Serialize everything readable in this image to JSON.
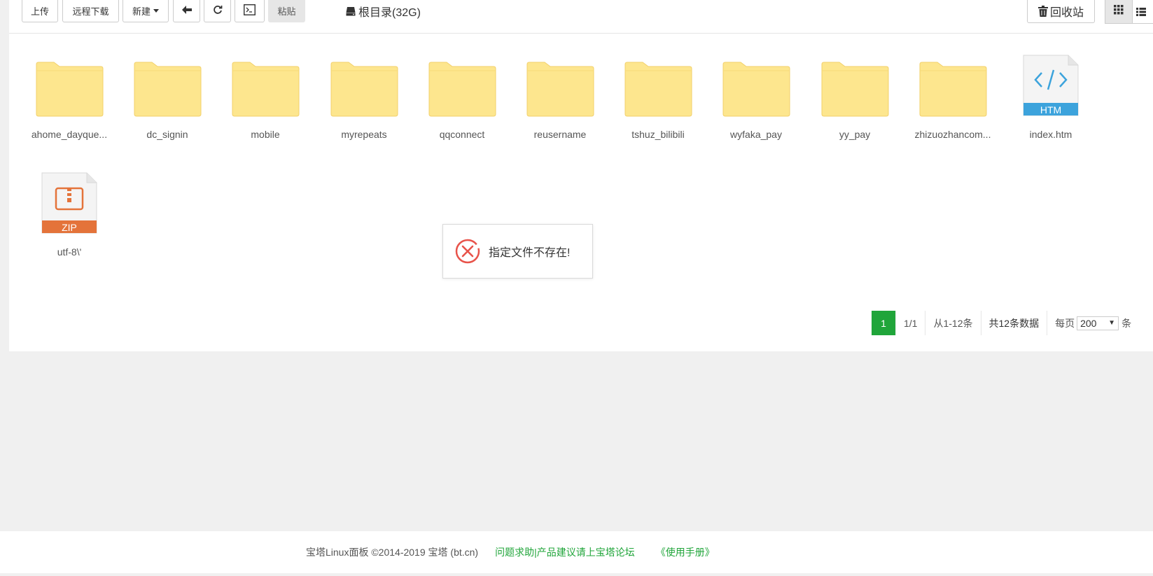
{
  "toolbar": {
    "upload": "上传",
    "remote_download": "远程下载",
    "new": "新建",
    "paste": "粘贴",
    "path": "根目录(32G)",
    "recycle": "回收站"
  },
  "files": [
    {
      "name": "ahome_dayque...",
      "type": "folder"
    },
    {
      "name": "dc_signin",
      "type": "folder"
    },
    {
      "name": "mobile",
      "type": "folder"
    },
    {
      "name": "myrepeats",
      "type": "folder"
    },
    {
      "name": "qqconnect",
      "type": "folder"
    },
    {
      "name": "reusername",
      "type": "folder"
    },
    {
      "name": "tshuz_bilibili",
      "type": "folder"
    },
    {
      "name": "wyfaka_pay",
      "type": "folder"
    },
    {
      "name": "yy_pay",
      "type": "folder"
    },
    {
      "name": "zhizuozhancom...",
      "type": "folder"
    },
    {
      "name": "index.htm",
      "type": "htm",
      "badge": "HTM"
    },
    {
      "name": "utf-8\\'",
      "type": "zip",
      "badge": "ZIP"
    }
  ],
  "toast": {
    "message": "指定文件不存在!"
  },
  "pager": {
    "current": "1",
    "pages": "1/1",
    "range": "从1-12条",
    "total": "共12条数据",
    "per_page_label": "每页",
    "per_page": "200",
    "suffix": "条"
  },
  "footer": {
    "copyright": "宝塔Linux面板 ©2014-2019 宝塔 (bt.cn)",
    "help": "问题求助|产品建议请上宝塔论坛",
    "manual": "《使用手册》"
  },
  "colors": {
    "folder": "#fde68e",
    "folder_border": "#f2d06b",
    "htm_badge": "#3ca3dc",
    "zip_badge": "#e4733a",
    "accent_green": "#20a53a",
    "error_red": "#e8534a"
  }
}
